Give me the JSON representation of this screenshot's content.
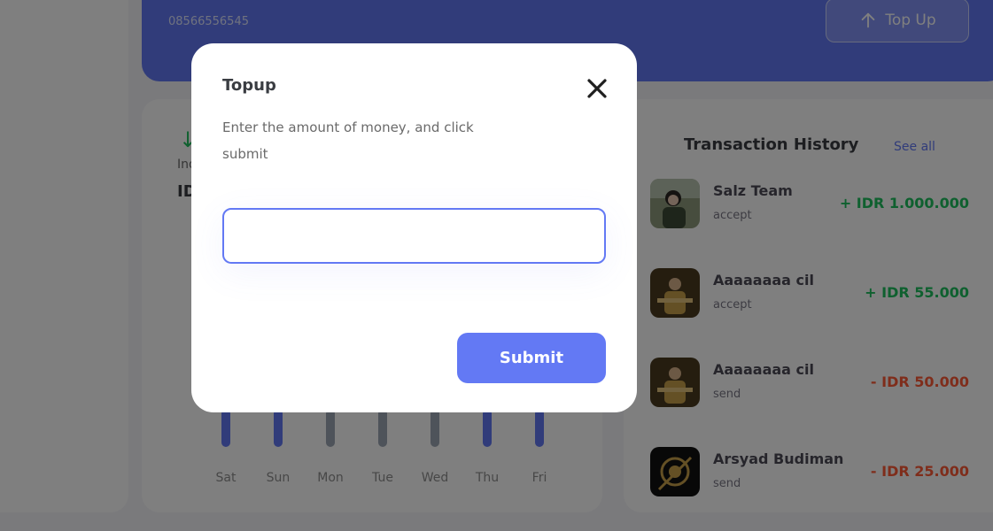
{
  "balance": {
    "phone": "08566556545",
    "topup_button": "Top Up"
  },
  "stats": {
    "income_label": "Ind",
    "income_value": "ID",
    "days": [
      "Sat",
      "Sun",
      "Mon",
      "Tue",
      "Wed",
      "Thu",
      "Fri"
    ],
    "bar_colors": [
      "#6379f4",
      "#6379f4",
      "#9da6b5",
      "#9da6b5",
      "#9da6b5",
      "#6379f4",
      "#6379f4"
    ]
  },
  "history": {
    "title": "Transaction History",
    "see_all": "See all",
    "transactions": [
      {
        "name": "Salz Team",
        "status": "accept",
        "amount": "+ IDR 1.000.000",
        "type": "in"
      },
      {
        "name": "Aaaaaaaa cil",
        "status": "accept",
        "amount": "+ IDR 55.000",
        "type": "in"
      },
      {
        "name": "Aaaaaaaa cil",
        "status": "send",
        "amount": "- IDR 50.000",
        "type": "out"
      },
      {
        "name": "Arsyad Budiman",
        "status": "send",
        "amount": "- IDR 25.000",
        "type": "out"
      }
    ]
  },
  "modal": {
    "title": "Topup",
    "description": "Enter the amount of money, and click submit",
    "input_value": "",
    "input_placeholder": "",
    "submit_label": "Submit"
  },
  "colors": {
    "primary": "#6379f4",
    "income": "#1ec15f",
    "expense": "#ff5b37"
  }
}
